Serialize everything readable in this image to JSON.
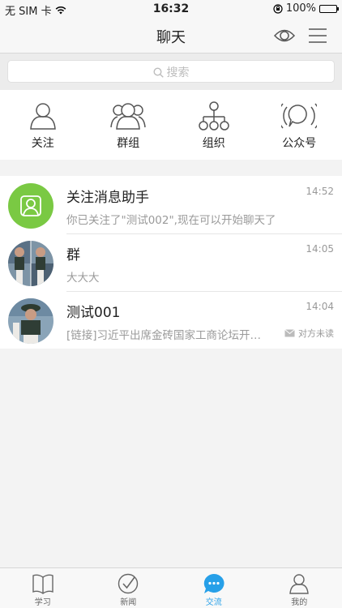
{
  "status_bar": {
    "carrier": "无 SIM 卡",
    "time": "16:32",
    "battery": "100%"
  },
  "nav": {
    "title": "聊天",
    "icons": [
      "eye-icon",
      "menu-icon"
    ]
  },
  "search": {
    "placeholder": "搜索"
  },
  "quick_actions": [
    {
      "label": "关注",
      "icon": "person-icon"
    },
    {
      "label": "群组",
      "icon": "group-icon"
    },
    {
      "label": "组织",
      "icon": "org-chart-icon"
    },
    {
      "label": "公众号",
      "icon": "broadcast-icon"
    }
  ],
  "chats": [
    {
      "name": "关注消息助手",
      "time": "14:52",
      "message": "你已关注了\"测试002\",现在可以开始聊天了",
      "status": ""
    },
    {
      "name": "群",
      "time": "14:05",
      "message": "大大大",
      "status": ""
    },
    {
      "name": "测试001",
      "time": "14:04",
      "message": "[链接]习近平出席金砖国家工商论坛开…",
      "status": "对方未读"
    }
  ],
  "tabs": [
    {
      "label": "学习",
      "icon": "book-icon",
      "active": false
    },
    {
      "label": "新闻",
      "icon": "check-circle-icon",
      "active": false
    },
    {
      "label": "交流",
      "icon": "chat-bubble-icon",
      "active": true
    },
    {
      "label": "我的",
      "icon": "person-icon",
      "active": false
    }
  ],
  "colors": {
    "accent": "#27a0e8",
    "assistant_avatar": "#7ac943"
  }
}
